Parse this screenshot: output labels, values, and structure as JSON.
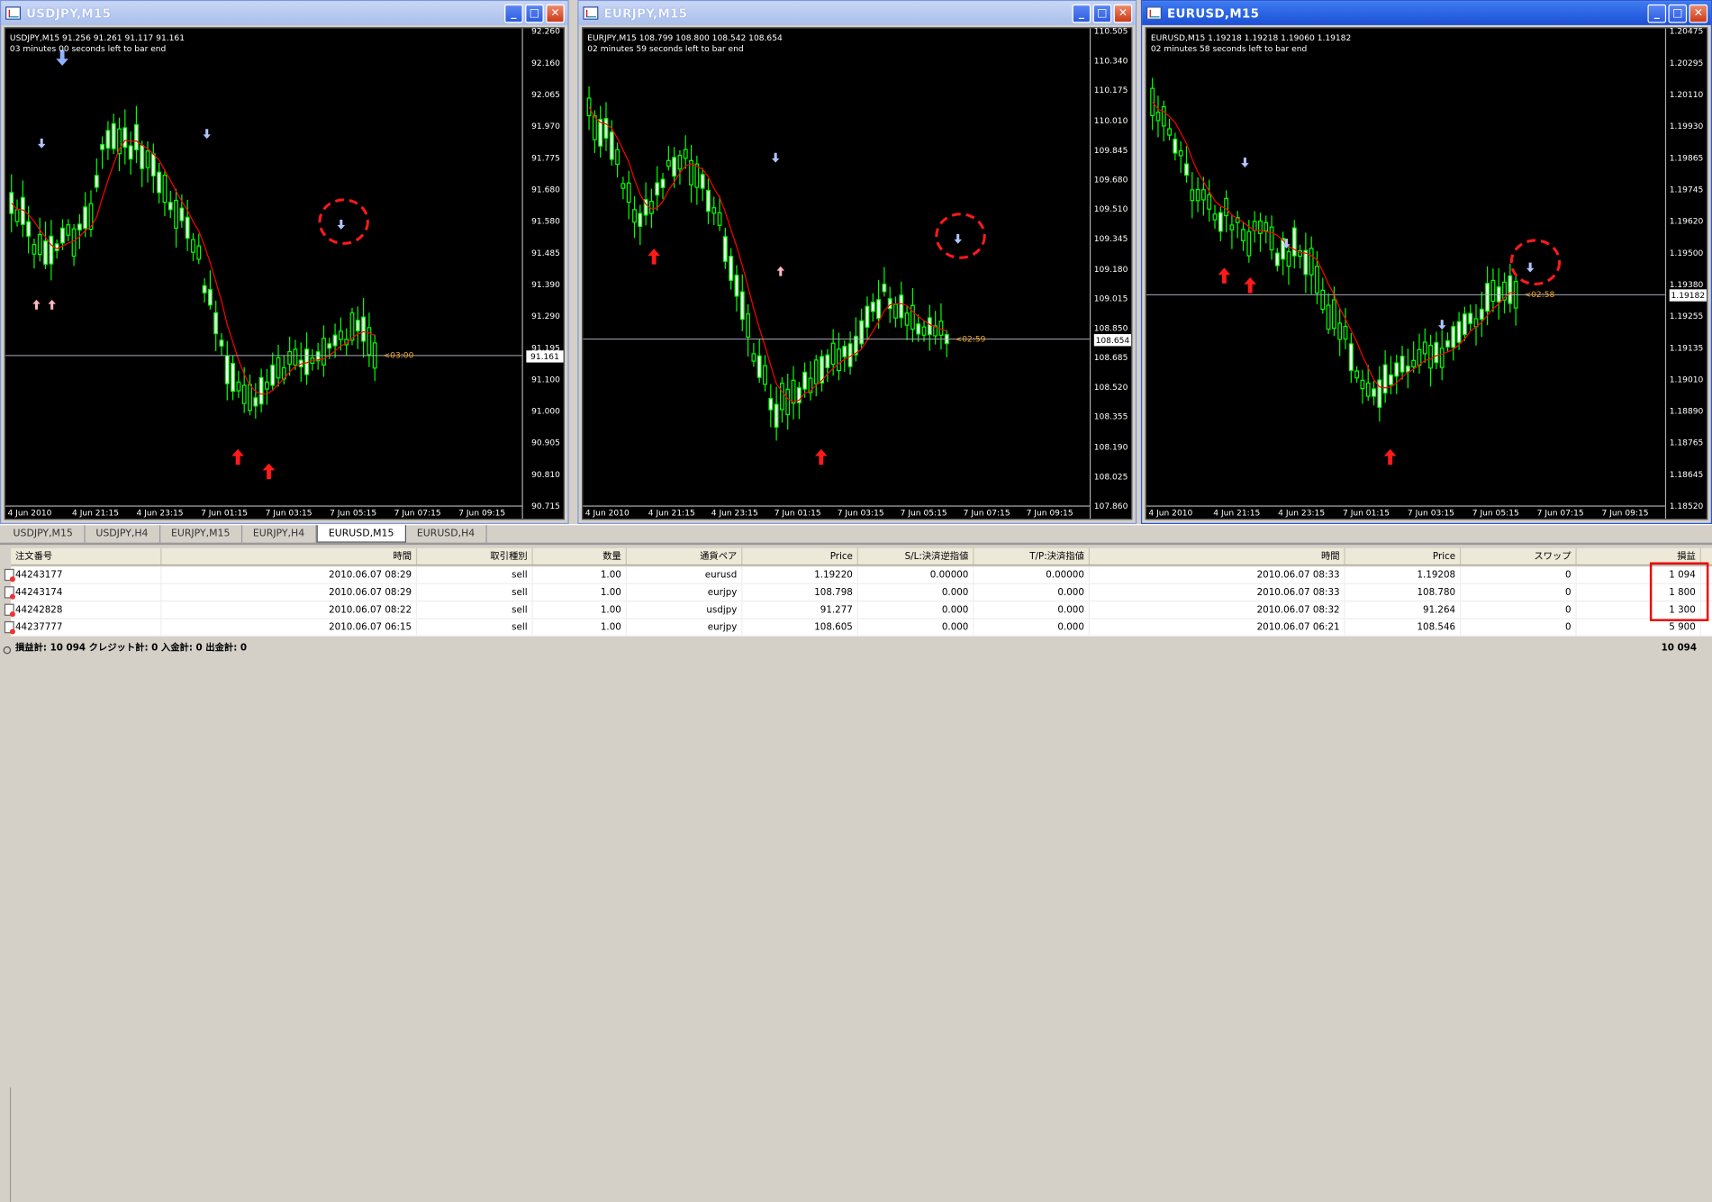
{
  "windows": [
    {
      "title": "USDJPY,M15",
      "ohlc": "USDJPY,M15  91.256 91.261 91.117 91.161",
      "timeleft": "03 minutes 00 seconds left to bar end",
      "price_labels": [
        "92.260",
        "92.160",
        "92.065",
        "91.970",
        "91.775",
        "91.680",
        "91.580",
        "91.485",
        "91.390",
        "91.290",
        "91.195",
        "91.100",
        "91.000",
        "90.905",
        "90.810",
        "90.715"
      ],
      "current_price": "91.161",
      "countdown": "<03:00",
      "time_labels": [
        "4 Jun 2010",
        "4 Jun 21:15",
        "4 Jun 23:15",
        "7 Jun 01:15",
        "7 Jun 03:15",
        "7 Jun 05:15",
        "7 Jun 07:15",
        "7 Jun 09:15"
      ]
    },
    {
      "title": "EURJPY,M15",
      "ohlc": "EURJPY,M15  108.799 108.800 108.542 108.654",
      "timeleft": "02 minutes 59 seconds left to bar end",
      "price_labels": [
        "110.505",
        "110.340",
        "110.175",
        "110.010",
        "109.845",
        "109.680",
        "109.510",
        "109.345",
        "109.180",
        "109.015",
        "108.850",
        "108.685",
        "108.520",
        "108.355",
        "108.190",
        "108.025",
        "107.860"
      ],
      "current_price": "108.654",
      "countdown": "<02:59",
      "time_labels": [
        "4 Jun 2010",
        "4 Jun 21:15",
        "4 Jun 23:15",
        "7 Jun 01:15",
        "7 Jun 03:15",
        "7 Jun 05:15",
        "7 Jun 07:15",
        "7 Jun 09:15"
      ]
    },
    {
      "title": "EURUSD,M15",
      "ohlc": "EURUSD,M15  1.19218 1.19218 1.19060 1.19182",
      "timeleft": "02 minutes 58 seconds left to bar end",
      "price_labels": [
        "1.20475",
        "1.20295",
        "1.20110",
        "1.19930",
        "1.19865",
        "1.19745",
        "1.19620",
        "1.19500",
        "1.19380",
        "1.19255",
        "1.19135",
        "1.19010",
        "1.18890",
        "1.18765",
        "1.18645",
        "1.18520"
      ],
      "current_price": "1.19182",
      "countdown": "<02:58",
      "time_labels": [
        "4 Jun 2010",
        "4 Jun 21:15",
        "4 Jun 23:15",
        "7 Jun 01:15",
        "7 Jun 03:15",
        "7 Jun 05:15",
        "7 Jun 07:15",
        "7 Jun 09:15"
      ]
    }
  ],
  "chart_tabs": [
    "USDJPY,M15",
    "USDJPY,H4",
    "EURJPY,M15",
    "EURJPY,H4",
    "EURUSD,M15",
    "EURUSD,H4"
  ],
  "active_tab": "EURUSD,M15",
  "terminal": {
    "headers": [
      "注文番号",
      "時間",
      "取引種別",
      "数量",
      "通貨ペア",
      "Price",
      "S/L:決済逆指値",
      "T/P:決済指値",
      "時間",
      "Price",
      "スワップ",
      "損益"
    ],
    "rows": [
      [
        "44243177",
        "2010.06.07 08:29",
        "sell",
        "1.00",
        "eurusd",
        "1.19220",
        "0.00000",
        "0.00000",
        "2010.06.07 08:33",
        "1.19208",
        "0",
        "1 094"
      ],
      [
        "44243174",
        "2010.06.07 08:29",
        "sell",
        "1.00",
        "eurjpy",
        "108.798",
        "0.000",
        "0.000",
        "2010.06.07 08:33",
        "108.780",
        "0",
        "1 800"
      ],
      [
        "44242828",
        "2010.06.07 08:22",
        "sell",
        "1.00",
        "usdjpy",
        "91.277",
        "0.000",
        "0.000",
        "2010.06.07 08:32",
        "91.264",
        "0",
        "1 300"
      ],
      [
        "44237777",
        "2010.06.07 06:15",
        "sell",
        "1.00",
        "eurjpy",
        "108.605",
        "0.000",
        "0.000",
        "2010.06.07 06:21",
        "108.546",
        "0",
        "5 900"
      ]
    ],
    "footer": "損益計: 10 094  クレジット計: 0  入金計: 0  出金計: 0",
    "footer_total": "10 094"
  },
  "colors": {
    "candle": "#00ff00",
    "ma": "#ff0000",
    "buy_arrow": "#ff0000",
    "sell_arrow": "#b0c4ff",
    "highlight": "#ff0000"
  }
}
